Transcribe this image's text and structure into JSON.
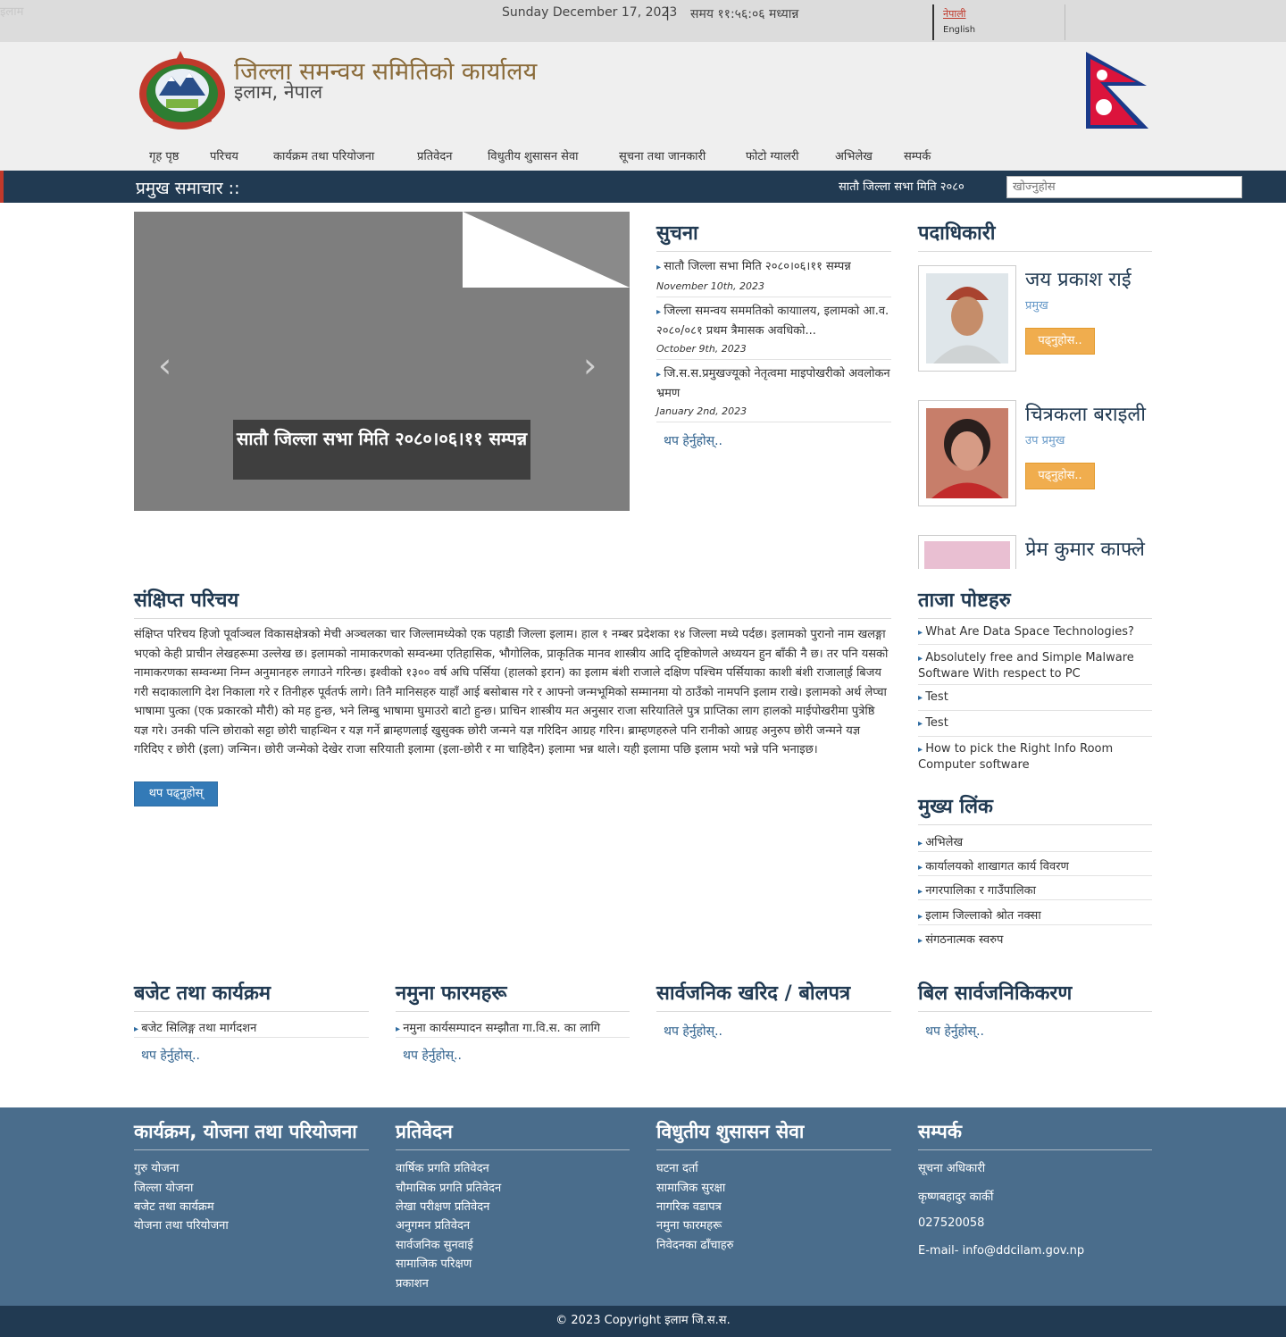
{
  "topbar": {
    "broken_image_alt": "इलाम",
    "date": "Sunday December 17, 2023",
    "separator": "|",
    "time": "समय ११:५६:०६ मध्यान्न",
    "lang_np": "नेपाली",
    "lang_en": "English"
  },
  "header": {
    "title": "जिल्ला समन्वय समितिको कार्यालय",
    "subtitle": "इलाम, नेपाल"
  },
  "nav": [
    "गृह पृष्ठ",
    "परिचय",
    "कार्यक्रम तथा परियोजना",
    "प्रतिवेदन",
    "विधुतीय शुसासन सेवा",
    "सूचना तथा जानकारी",
    "फोटो ग्यालरी",
    "अभिलेख",
    "सम्पर्क"
  ],
  "newsbar": {
    "label": "प्रमुख समाचार ::",
    "ticker": "सातौ जिल्ला सभा मिति २०८०",
    "search_placeholder": "खोज्नुहोस"
  },
  "slider": {
    "prev": "‹",
    "next": "›",
    "caption": "सातौ जिल्ला सभा मिति २०८०।०६।११ सम्पन्न"
  },
  "notices": {
    "heading": "सुचना",
    "items": [
      {
        "text": "सातौ जिल्ला सभा मिति २०८०।०६।११ सम्पन्न",
        "date": "November 10th, 2023"
      },
      {
        "text": "जिल्ला समन्वय सममतिको कायाालय, इलामको आ.व. २०८०/०८१ प्रथम त्रैमासक अवधिको...",
        "date": "October 9th, 2023"
      },
      {
        "text": "जि.स.स.प्रमुखज्यूको नेतृत्वमा माइपोखरीको अवलोकन भ्रमण",
        "date": "January 2nd, 2023"
      }
    ],
    "more": "थप हेर्नुहोस्.."
  },
  "officials": {
    "heading": "पदाधिकारी",
    "read_more": "पढ्नुहोस..",
    "people": [
      {
        "name": "जय प्रकाश राई",
        "role": "प्रमुख"
      },
      {
        "name": "चित्रकला बराइली",
        "role": "उप प्रमुख"
      },
      {
        "name": "प्रेम कुमार काफ्ले",
        "role": ""
      }
    ]
  },
  "intro": {
    "heading": "संक्षिप्त परिचय",
    "text": "संक्षिप्त परिचय हिजो पूर्वाञ्चल विकासक्षेत्रको मेची अञ्चलका चार जिल्लामध्येको एक पहाडी जिल्ला इलाम। हाल १ नम्बर प्रदेशका १४ जिल्ला मध्ये पर्दछ। इलामको पुरानो नाम खलङ्गा भएको केही प्राचीन लेखहरूमा उल्लेख छ। इलामको नामाकरणको सम्वन्ध्मा एतिहासिक, भौगोलिक, प्राकृतिक मानव शास्त्रीय आदि दृष्टिकोणले अध्ययन हुन बाँकी नै छ। तर पनि यसको नामाकरणका सम्वन्ध्मा निम्न अनुमानहरु लगाउने गरिन्छ। इश्वीको १३०० वर्ष अघि पर्सिया (हालको इरान) का इलाम बंशी राजाले दक्षिण पश्चिम पर्सियाका काशी बंशी राजाला्ई बिजय गरी सदाकालागि देश निकाला गरे र तिनीहरु पूर्वतर्फ लागे। तिनै मानिसहरु याहाँ आई बसोबास गरे र आफ्नो जन्मभूमिको सम्मानमा यो ठाउँको नामपनि इलाम राखे। इलामको अर्थ लेप्चा भाषामा पुत्का (एक प्रकारको मौरी) को मह हुन्छ, भने लिम्बु भाषामा घुमाउरो बाटो हुन्छ। प्राचिन शास्त्रीय मत अनुसार राजा सरियातिले पुत्र प्राप्तिका लाग हालको माईपोखरीमा पुत्रेष्ठि यज्ञ गरे। उनकी पत्नि छोराको सट्टा छोरी चाहन्थिन र यज्ञ गर्ने ब्राम्हणलाई खुसुक्क छोरी जन्मने यज्ञ गरिदिन आग्रह गरिन। ब्राम्हणहरुले पनि रानीको आग्रह अनुरुप छोरी जन्मने यज्ञ गरिदिए र छोरी (इला) जन्मिन। छोरी जन्मेको देखेर राजा सरियाती इलामा (इला-छोरी र मा चाहिदैन) इलामा भन्न थाले। यही इलामा पछि इलाम भयो भन्ने पनि भनाइछ।",
    "button": "थप पढ्नुहोस्"
  },
  "latest_posts": {
    "heading": "ताजा पोष्टहरु",
    "items": [
      "What Are Data Space Technologies?",
      "Absolutely free and Simple Malware Software With respect to PC",
      "Test",
      "Test",
      "How to pick the Right Info Room Computer software"
    ]
  },
  "main_links": {
    "heading": "मुख्य लिंक",
    "items": [
      "अभिलेख",
      "कार्यालयको शाखागत कार्य विवरण",
      "नगरपालिका र गाउँपालिका",
      "इलाम जिल्लाको श्रोत नक्सा",
      "संगठनात्मक स्वरुप"
    ]
  },
  "bottom_sections": [
    {
      "heading": "बजेट तथा कार्यक्रम",
      "items": [
        "बजेट सिलिङ्ग तथा मार्गदशन"
      ],
      "more": "थप हेर्नुहोस्.."
    },
    {
      "heading": "नमुना फारमहरू",
      "items": [
        "नमुना कार्यसम्पादन सम्झौता गा.वि.स. का लागि"
      ],
      "more": "थप हेर्नुहोस्.."
    },
    {
      "heading": "सार्वजनिक खरिद / बोलपत्र",
      "items": [],
      "more": "थप हेर्नुहोस्.."
    },
    {
      "heading": "बिल सार्वजनिकिकरण",
      "items": [],
      "more": "थप हेर्नुहोस्.."
    }
  ],
  "footer": {
    "columns": [
      {
        "heading": "कार्यक्रम, योजना तथा परियोजना",
        "items": [
          "गुरु योजना",
          "जिल्ला योजना",
          "बजेट तथा कार्यक्रम",
          "योजना तथा परियोजना"
        ]
      },
      {
        "heading": "प्रतिवेदन",
        "items": [
          "वार्षिक प्रगति प्रतिवेदन",
          "चौमासिक प्रगति प्रतिवेदन",
          "लेखा परीक्षण प्रतिवेदन",
          "अनुगमन प्रतिवेदन",
          "सार्वजनिक सुनवाई",
          "सामाजिक परिक्षण",
          "प्रकाशन"
        ]
      },
      {
        "heading": "विधुतीय शुसासन सेवा",
        "items": [
          "घटना दर्ता",
          "सामाजिक सुरक्षा",
          "नागरिक वडापत्र",
          "नमुना फारमहरू",
          "निवेदनका ढाँचाहरु"
        ]
      },
      {
        "heading": "सम्पर्क",
        "items": [
          "सूचना अधिकारी",
          "कृष्णबहादुर कार्की",
          "027520058",
          "E-mail- info@ddcilam.gov.np"
        ]
      }
    ],
    "copyright": "© 2023 Copyright इलाम जि.स.स."
  },
  "colors": {
    "navy": "#213a52",
    "footer_blue": "#4a6d8c",
    "orange_button": "#f0ad4e",
    "blue_button": "#337ab7",
    "title_brown": "#8a6b3a"
  }
}
